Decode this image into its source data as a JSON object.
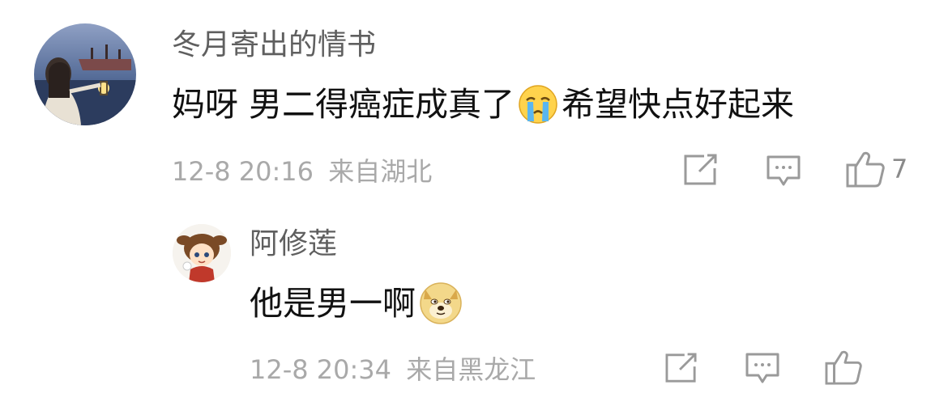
{
  "comments": [
    {
      "username": "冬月寄出的情书",
      "text_before": "妈呀 男二得癌症成真了",
      "emoji": "crying-face-icon",
      "text_after": "希望快点好起来",
      "time": "12-8 20:16",
      "location": "来自湖北",
      "likes": "7"
    },
    {
      "username": "阿修莲",
      "text_before": "他是男一啊",
      "emoji": "doge-icon",
      "time": "12-8 20:34",
      "location": "来自黑龙江"
    }
  ],
  "colors": {
    "username": "#5f5f5f",
    "text": "#111111",
    "meta": "#a9a9a9",
    "icon": "#9a9a9a"
  }
}
